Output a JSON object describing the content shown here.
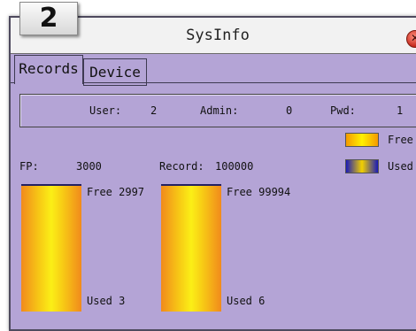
{
  "step_badge": "2",
  "window": {
    "title": "SysInfo"
  },
  "tabs": [
    {
      "label": "Records",
      "selected": true
    },
    {
      "label": "Device",
      "selected": false
    }
  ],
  "summary": {
    "user_label": "User:",
    "user_value": "2",
    "admin_label": "Admin:",
    "admin_value": "0",
    "pwd_label": "Pwd:",
    "pwd_value": "1"
  },
  "legend": {
    "free_label": "Free",
    "used_label": "Used"
  },
  "fp": {
    "label": "FP:",
    "capacity": "3000",
    "free_label": "Free 2997",
    "used_label": "Used 3",
    "used_fraction": 0.001
  },
  "record": {
    "label": "Record:",
    "capacity": "100000",
    "free_label": "Free 99994",
    "used_label": "Used 6",
    "used_fraction": 6e-05
  },
  "colors": {
    "window_bg": "#b4a4d6",
    "free_gradient_edge": "#f18a1c",
    "free_gradient_center": "#fbef16",
    "used_color": "#232062"
  }
}
